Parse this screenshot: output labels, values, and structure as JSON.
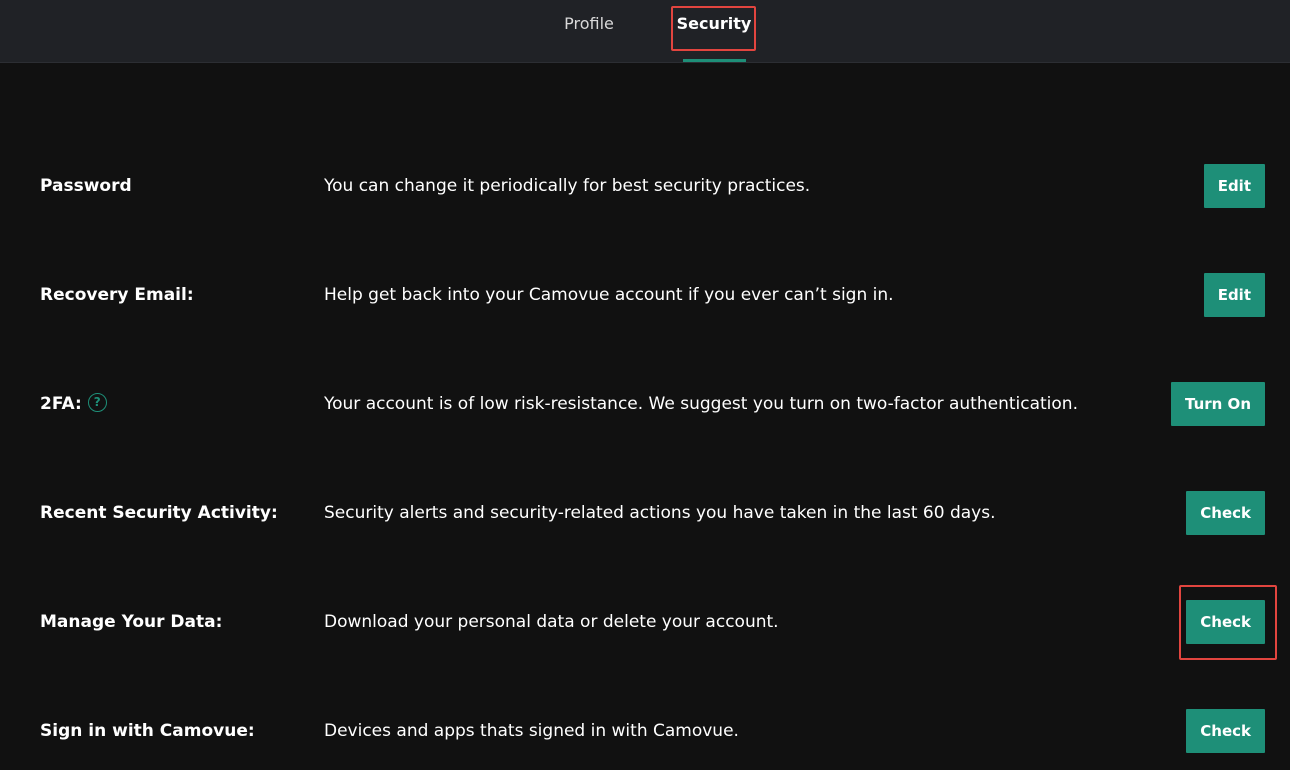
{
  "tabs": {
    "profile": "Profile",
    "security": "Security"
  },
  "rows": [
    {
      "label": "Password",
      "description": "You can change it periodically for best security practices.",
      "button": "Edit"
    },
    {
      "label": "Recovery Email:",
      "description": "Help get back into your Camovue account if you ever can’t sign in.",
      "button": "Edit"
    },
    {
      "label": "2FA:",
      "description": "Your account is of low risk-resistance. We suggest you turn on two-factor authentication.",
      "button": "Turn On",
      "icon": "?"
    },
    {
      "label": "Recent Security Activity:",
      "description": "Security alerts and security-related actions you have taken in the last 60 days.",
      "button": "Check"
    },
    {
      "label": "Manage Your Data:",
      "description": "Download your personal data or delete your account.",
      "button": "Check"
    },
    {
      "label": "Sign in with Camovue:",
      "description": "Devices and apps thats signed in with Camovue.",
      "button": "Check"
    }
  ],
  "colors": {
    "accent": "#1e8f78",
    "highlight": "#e2453f",
    "background": "#111111",
    "topbar": "#202226"
  }
}
